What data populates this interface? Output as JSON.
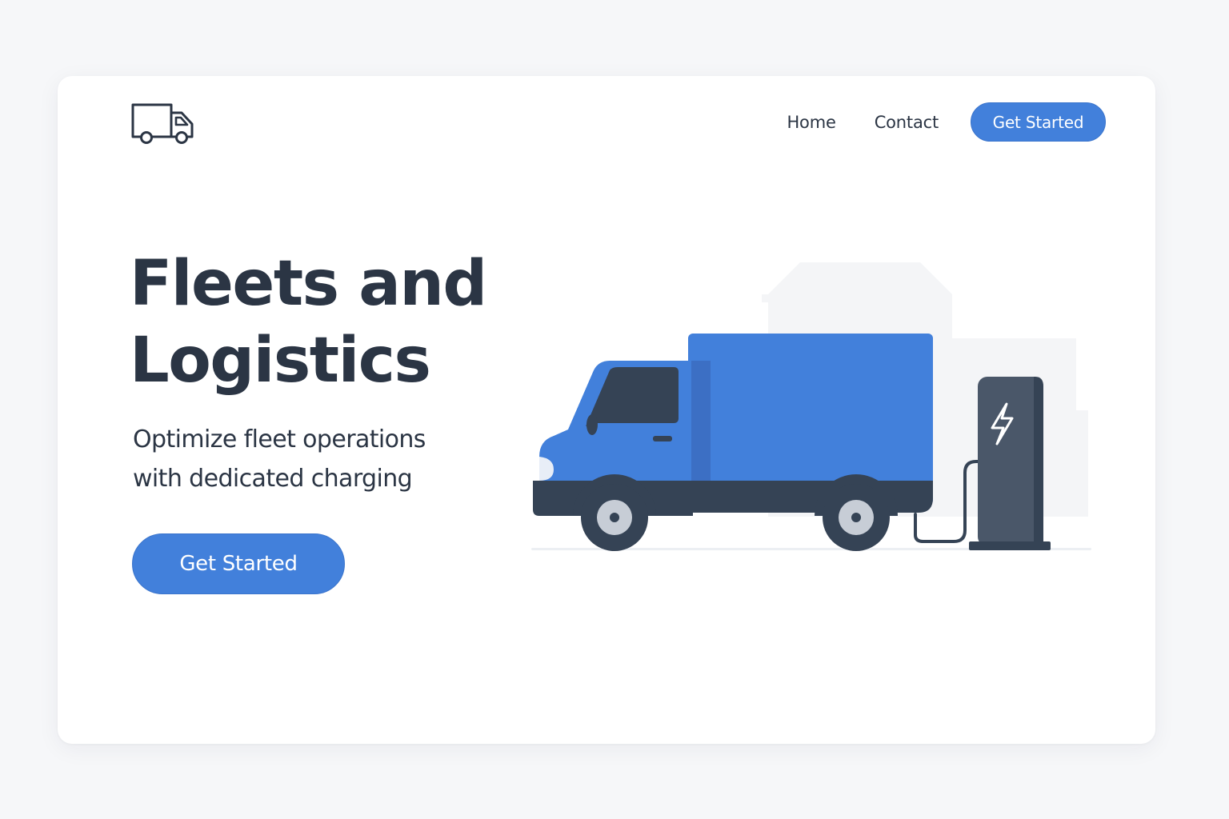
{
  "header": {
    "logo_icon": "truck-icon",
    "nav": {
      "home_label": "Home",
      "contact_label": "Contact",
      "cta_label": "Get Started"
    }
  },
  "hero": {
    "title_line1": "Fleets and",
    "title_line2": "Logistics",
    "subtitle_line1": "Optimize fleet operations",
    "subtitle_line2": "with dedicated charging",
    "cta_label": "Get Started",
    "illustration": {
      "truck_icon": "electric-truck-illustration",
      "charger_icon": "ev-charger-illustration",
      "bolt_icon": "lightning-bolt-icon"
    }
  },
  "colors": {
    "accent": "#4280db",
    "text": "#2b3544",
    "truck_dark": "#354355",
    "background": "#f6f7f9",
    "card": "#ffffff"
  }
}
